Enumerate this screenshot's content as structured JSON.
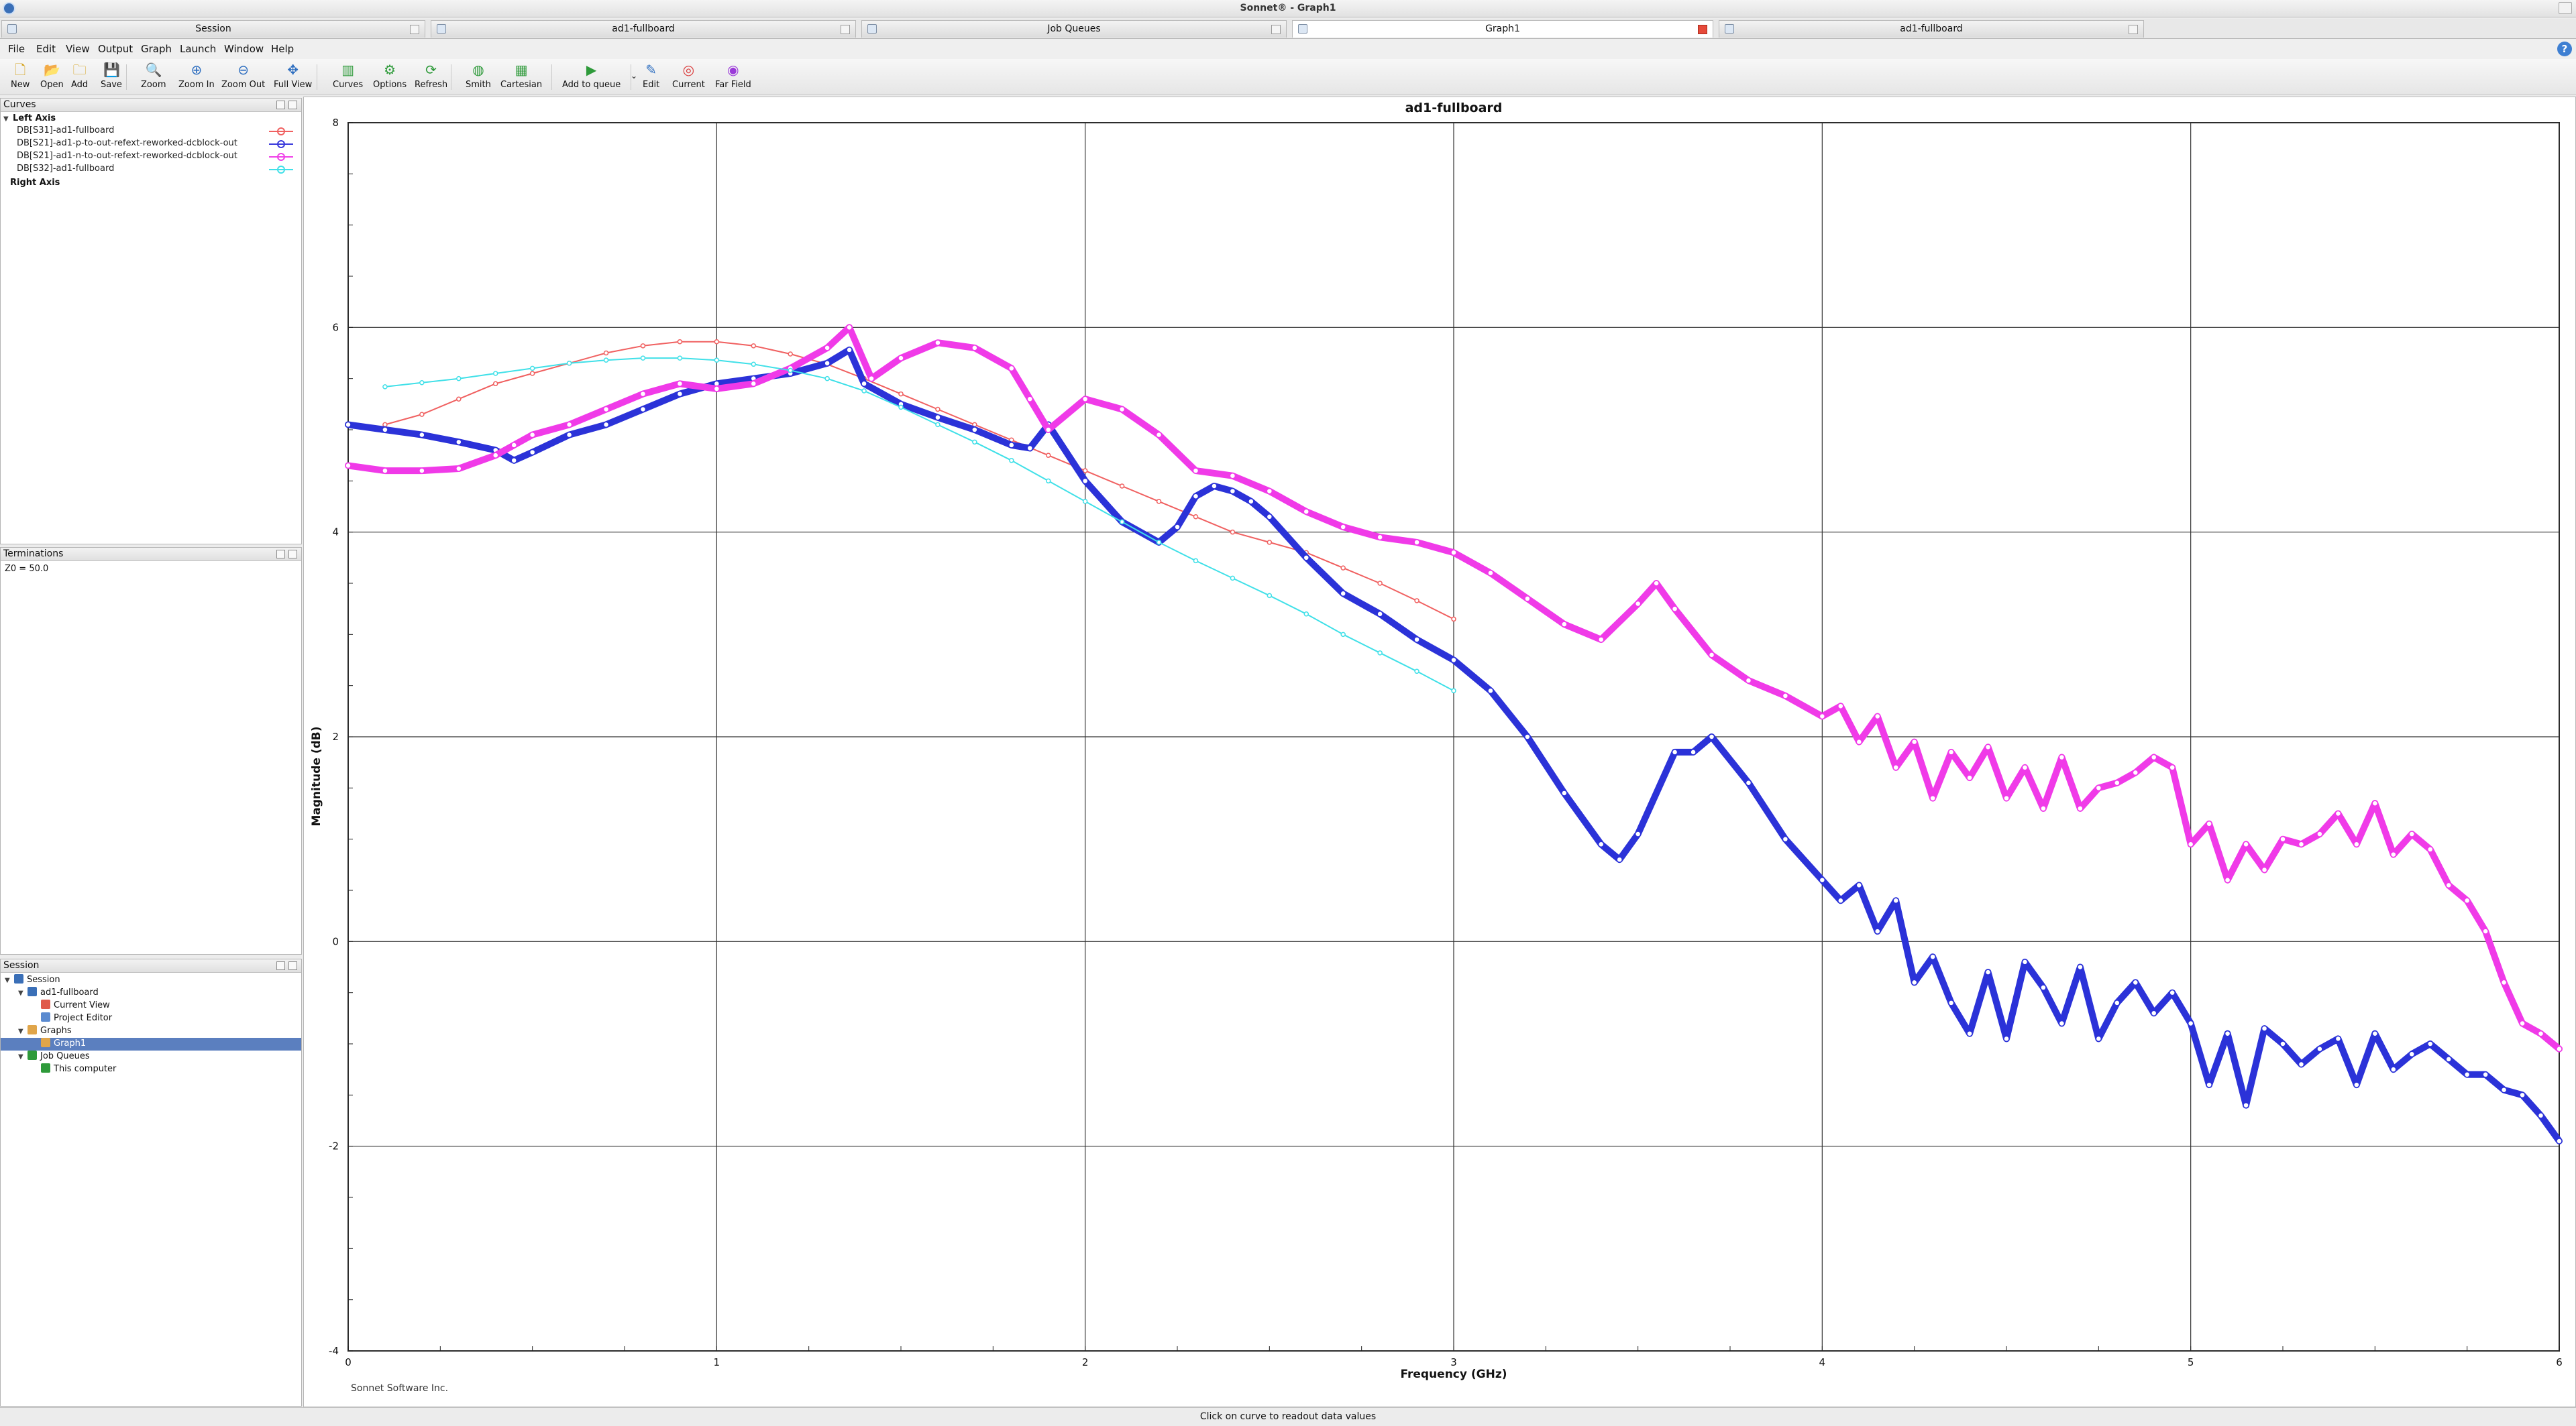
{
  "window": {
    "title": "Sonnet® - Graph1"
  },
  "tabs": [
    {
      "label": "Session",
      "active": false
    },
    {
      "label": "ad1-fullboard",
      "active": false
    },
    {
      "label": "Job Queues",
      "active": false
    },
    {
      "label": "Graph1",
      "active": true
    },
    {
      "label": "ad1-fullboard",
      "active": false
    }
  ],
  "menu": [
    "File",
    "Edit",
    "View",
    "Output",
    "Graph",
    "Launch",
    "Window",
    "Help"
  ],
  "help_symbol": "?",
  "toolbar": [
    {
      "label": "New",
      "icon": "new-file-icon",
      "glyph": "🗋",
      "color": "#d4a017"
    },
    {
      "label": "Open",
      "icon": "open-folder-icon",
      "glyph": "📂",
      "color": "#d4a017"
    },
    {
      "label": "Add",
      "icon": "add-file-icon",
      "glyph": "🗀",
      "color": "#d4a017"
    },
    {
      "label": "Save",
      "icon": "save-icon",
      "glyph": "💾",
      "color": "#d4a017"
    },
    {
      "label": "Zoom",
      "icon": "zoom-icon",
      "glyph": "🔍",
      "color": "#2f6fc0"
    },
    {
      "label": "Zoom In",
      "icon": "zoom-in-icon",
      "glyph": "⊕",
      "color": "#2f6fc0"
    },
    {
      "label": "Zoom Out",
      "icon": "zoom-out-icon",
      "glyph": "⊖",
      "color": "#2f6fc0"
    },
    {
      "label": "Full View",
      "icon": "full-view-icon",
      "glyph": "✥",
      "color": "#2f6fc0"
    },
    {
      "label": "Curves",
      "icon": "curves-icon",
      "glyph": "▥",
      "color": "#2e9a3a"
    },
    {
      "label": "Options",
      "icon": "options-icon",
      "glyph": "⚙",
      "color": "#2e9a3a"
    },
    {
      "label": "Refresh",
      "icon": "refresh-icon",
      "glyph": "⟳",
      "color": "#2e9a3a"
    },
    {
      "label": "Smith",
      "icon": "smith-chart-icon",
      "glyph": "◍",
      "color": "#2e9a3a"
    },
    {
      "label": "Cartesian",
      "icon": "cartesian-icon",
      "glyph": "▦",
      "color": "#2e9a3a"
    },
    {
      "label": "Add to queue",
      "icon": "add-to-queue-icon",
      "glyph": "▶",
      "color": "#2e9a3a"
    },
    {
      "label": "Edit",
      "icon": "edit-icon",
      "glyph": "✎",
      "color": "#2f6fc0"
    },
    {
      "label": "Current",
      "icon": "current-icon",
      "glyph": "◎",
      "color": "#d93a3a"
    },
    {
      "label": "Far Field",
      "icon": "far-field-icon",
      "glyph": "◉",
      "color": "#9b3ad9"
    }
  ],
  "curves_panel": {
    "title": "Curves",
    "left_axis_label": "Left Axis",
    "right_axis_label": "Right Axis",
    "items": [
      {
        "label": "DB[S31]-ad1-fullboard",
        "color": "#f06060"
      },
      {
        "label": "DB[S21]-ad1-p-to-out-refext-reworked-dcblock-out",
        "color": "#3a3adc"
      },
      {
        "label": "DB[S21]-ad1-n-to-out-refext-reworked-dcblock-out",
        "color": "#f040e8"
      },
      {
        "label": "DB[S32]-ad1-fullboard",
        "color": "#40e0e8"
      }
    ]
  },
  "terminations_panel": {
    "title": "Terminations",
    "text": "Z0 = 50.0"
  },
  "session_panel": {
    "title": "Session",
    "tree": [
      {
        "label": "Session",
        "level": 0,
        "icon": "session-icon",
        "toggle": true,
        "selected": false
      },
      {
        "label": "ad1-fullboard",
        "level": 1,
        "icon": "project-icon",
        "toggle": true,
        "selected": false
      },
      {
        "label": "Current View",
        "level": 2,
        "icon": "current-view-icon",
        "toggle": false,
        "selected": false
      },
      {
        "label": "Project Editor",
        "level": 2,
        "icon": "project-editor-icon",
        "toggle": false,
        "selected": false
      },
      {
        "label": "Graphs",
        "level": 1,
        "icon": "graphs-folder-icon",
        "toggle": true,
        "selected": false
      },
      {
        "label": "Graph1",
        "level": 2,
        "icon": "graph-icon",
        "toggle": false,
        "selected": true
      },
      {
        "label": "Job Queues",
        "level": 1,
        "icon": "job-queues-icon",
        "toggle": true,
        "selected": false
      },
      {
        "label": "This computer",
        "level": 2,
        "icon": "computer-icon",
        "toggle": false,
        "selected": false
      }
    ]
  },
  "graph": {
    "footer": "Sonnet Software Inc."
  },
  "status": {
    "text": "Click on curve to readout data values"
  },
  "chart_data": {
    "type": "line",
    "title": "ad1-fullboard",
    "xlabel": "Frequency (GHz)",
    "ylabel": "Magnitude (dB)",
    "xlim": [
      0,
      6
    ],
    "ylim": [
      -4,
      8
    ],
    "xticks": [
      0,
      1,
      2,
      3,
      4,
      5,
      6
    ],
    "yticks": [
      -4,
      -2,
      0,
      2,
      4,
      6,
      8
    ],
    "grid": true,
    "series": [
      {
        "name": "DB[S31]-ad1-fullboard",
        "color": "#f06060",
        "width": 2,
        "x": [
          0.1,
          0.2,
          0.3,
          0.4,
          0.5,
          0.6,
          0.7,
          0.8,
          0.9,
          1.0,
          1.1,
          1.2,
          1.3,
          1.4,
          1.5,
          1.6,
          1.7,
          1.8,
          1.9,
          2.0,
          2.1,
          2.2,
          2.3,
          2.4,
          2.5,
          2.6,
          2.7,
          2.8,
          2.9,
          3.0
        ],
        "y": [
          5.05,
          5.15,
          5.3,
          5.45,
          5.55,
          5.65,
          5.75,
          5.82,
          5.86,
          5.86,
          5.82,
          5.74,
          5.64,
          5.5,
          5.35,
          5.2,
          5.05,
          4.9,
          4.75,
          4.6,
          4.45,
          4.3,
          4.15,
          4.0,
          3.9,
          3.8,
          3.65,
          3.5,
          3.33,
          3.15
        ]
      },
      {
        "name": "DB[S21]-ad1-p-to-out-refext-reworked-dcblock-out",
        "color": "#2b32d8",
        "width": 10,
        "x": [
          0.0,
          0.1,
          0.2,
          0.3,
          0.4,
          0.45,
          0.5,
          0.6,
          0.7,
          0.8,
          0.9,
          1.0,
          1.1,
          1.2,
          1.3,
          1.36,
          1.4,
          1.5,
          1.6,
          1.7,
          1.8,
          1.85,
          1.9,
          2.0,
          2.1,
          2.2,
          2.25,
          2.3,
          2.35,
          2.4,
          2.45,
          2.5,
          2.6,
          2.7,
          2.8,
          2.9,
          3.0,
          3.1,
          3.2,
          3.3,
          3.4,
          3.45,
          3.5,
          3.6,
          3.65,
          3.7,
          3.8,
          3.9,
          4.0,
          4.05,
          4.1,
          4.15,
          4.2,
          4.25,
          4.3,
          4.35,
          4.4,
          4.45,
          4.5,
          4.55,
          4.6,
          4.65,
          4.7,
          4.75,
          4.8,
          4.85,
          4.9,
          4.95,
          5.0,
          5.05,
          5.1,
          5.15,
          5.2,
          5.25,
          5.3,
          5.35,
          5.4,
          5.45,
          5.5,
          5.55,
          5.6,
          5.65,
          5.7,
          5.75,
          5.8,
          5.85,
          5.9,
          5.95,
          6.0
        ],
        "y": [
          5.05,
          5.0,
          4.95,
          4.88,
          4.8,
          4.7,
          4.78,
          4.95,
          5.05,
          5.2,
          5.35,
          5.45,
          5.5,
          5.55,
          5.65,
          5.78,
          5.45,
          5.25,
          5.12,
          5.0,
          4.85,
          4.82,
          5.05,
          4.5,
          4.1,
          3.9,
          4.05,
          4.35,
          4.45,
          4.4,
          4.3,
          4.15,
          3.75,
          3.4,
          3.2,
          2.95,
          2.75,
          2.45,
          2.0,
          1.45,
          0.95,
          0.8,
          1.05,
          1.85,
          1.85,
          2.0,
          1.55,
          1.0,
          0.6,
          0.4,
          0.55,
          0.1,
          0.4,
          -0.4,
          -0.15,
          -0.6,
          -0.9,
          -0.3,
          -0.95,
          -0.2,
          -0.45,
          -0.8,
          -0.25,
          -0.95,
          -0.6,
          -0.4,
          -0.7,
          -0.5,
          -0.8,
          -1.4,
          -0.9,
          -1.6,
          -0.85,
          -1.0,
          -1.2,
          -1.05,
          -0.95,
          -1.4,
          -0.9,
          -1.25,
          -1.1,
          -1.0,
          -1.15,
          -1.3,
          -1.3,
          -1.45,
          -1.5,
          -1.7,
          -1.95
        ]
      },
      {
        "name": "DB[S21]-ad1-n-to-out-refext-reworked-dcblock-out",
        "color": "#f03ae8",
        "width": 10,
        "x": [
          0.0,
          0.1,
          0.2,
          0.3,
          0.4,
          0.45,
          0.5,
          0.6,
          0.7,
          0.8,
          0.9,
          1.0,
          1.1,
          1.2,
          1.3,
          1.36,
          1.42,
          1.5,
          1.6,
          1.7,
          1.8,
          1.85,
          1.9,
          2.0,
          2.1,
          2.2,
          2.3,
          2.4,
          2.5,
          2.6,
          2.7,
          2.8,
          2.9,
          3.0,
          3.1,
          3.2,
          3.3,
          3.4,
          3.5,
          3.55,
          3.6,
          3.7,
          3.8,
          3.9,
          4.0,
          4.05,
          4.1,
          4.15,
          4.2,
          4.25,
          4.3,
          4.35,
          4.4,
          4.45,
          4.5,
          4.55,
          4.6,
          4.65,
          4.7,
          4.75,
          4.8,
          4.85,
          4.9,
          4.95,
          5.0,
          5.05,
          5.1,
          5.15,
          5.2,
          5.25,
          5.3,
          5.35,
          5.4,
          5.45,
          5.5,
          5.55,
          5.6,
          5.65,
          5.7,
          5.75,
          5.8,
          5.85,
          5.9,
          5.95,
          6.0
        ],
        "y": [
          4.65,
          4.6,
          4.6,
          4.62,
          4.75,
          4.85,
          4.95,
          5.05,
          5.2,
          5.35,
          5.45,
          5.4,
          5.45,
          5.6,
          5.8,
          6.0,
          5.5,
          5.7,
          5.85,
          5.8,
          5.6,
          5.3,
          5.0,
          5.3,
          5.2,
          4.95,
          4.6,
          4.55,
          4.4,
          4.2,
          4.05,
          3.95,
          3.9,
          3.8,
          3.6,
          3.35,
          3.1,
          2.95,
          3.3,
          3.5,
          3.25,
          2.8,
          2.55,
          2.4,
          2.2,
          2.3,
          1.95,
          2.2,
          1.7,
          1.95,
          1.4,
          1.85,
          1.6,
          1.9,
          1.4,
          1.7,
          1.3,
          1.8,
          1.3,
          1.5,
          1.55,
          1.65,
          1.8,
          1.7,
          0.95,
          1.15,
          0.6,
          0.95,
          0.7,
          1.0,
          0.95,
          1.05,
          1.25,
          0.95,
          1.35,
          0.85,
          1.05,
          0.9,
          0.55,
          0.4,
          0.1,
          -0.4,
          -0.8,
          -0.9,
          -1.05
        ]
      },
      {
        "name": "DB[S32]-ad1-fullboard",
        "color": "#40e0e8",
        "width": 2,
        "x": [
          0.1,
          0.2,
          0.3,
          0.4,
          0.5,
          0.6,
          0.7,
          0.8,
          0.9,
          1.0,
          1.1,
          1.2,
          1.3,
          1.4,
          1.5,
          1.6,
          1.7,
          1.8,
          1.9,
          2.0,
          2.1,
          2.2,
          2.3,
          2.4,
          2.5,
          2.6,
          2.7,
          2.8,
          2.9,
          3.0
        ],
        "y": [
          5.42,
          5.46,
          5.5,
          5.55,
          5.6,
          5.65,
          5.68,
          5.7,
          5.7,
          5.68,
          5.64,
          5.58,
          5.5,
          5.38,
          5.22,
          5.05,
          4.88,
          4.7,
          4.5,
          4.3,
          4.1,
          3.9,
          3.72,
          3.55,
          3.38,
          3.2,
          3.0,
          2.82,
          2.64,
          2.45
        ]
      }
    ]
  }
}
